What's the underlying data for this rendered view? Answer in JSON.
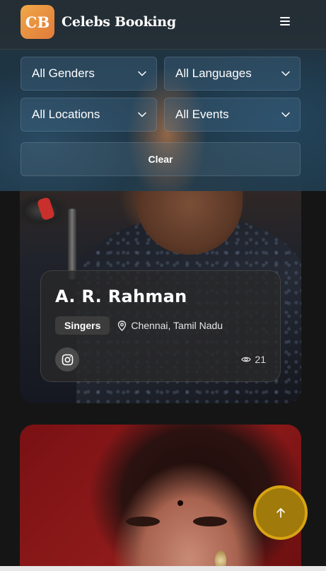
{
  "header": {
    "logo_text": "CB",
    "brand_name": "Celebs Booking",
    "menu_icon": "hamburger-menu-icon"
  },
  "filters": {
    "gender": "All Genders",
    "language": "All Languages",
    "location": "All Locations",
    "event": "All Events",
    "clear_label": "Clear"
  },
  "cards": [
    {
      "name": "A. R. Rahman",
      "category": "Singers",
      "location": "Chennai, Tamil Nadu",
      "views": "21",
      "social_icon": "instagram-icon"
    },
    {
      "name": "",
      "category": "",
      "location": "",
      "views": ""
    }
  ],
  "colors": {
    "logo_gradient_start": "#f0a848",
    "logo_gradient_end": "#e07a3a",
    "scroll_top_fill": "#a07a0a",
    "scroll_top_border": "#d7a412"
  },
  "scroll_top_icon": "arrow-up-icon"
}
